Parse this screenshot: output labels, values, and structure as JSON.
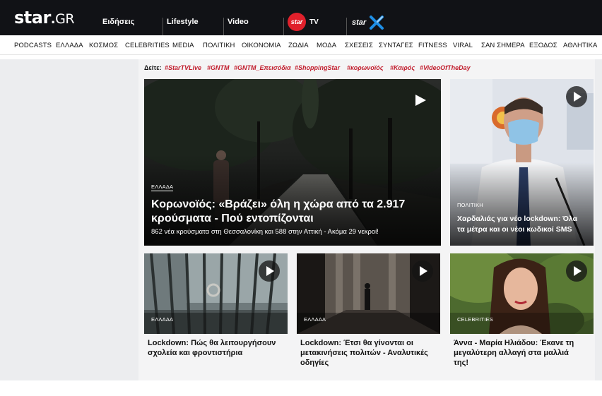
{
  "header": {
    "logo_star": "star",
    "logo_dot": ".",
    "logo_gr": "GR",
    "nav": [
      "Ειδήσεις",
      "Lifestyle",
      "Video"
    ],
    "startv_badge": "star",
    "startv_tv": "TV",
    "starx_text": "star"
  },
  "categories": [
    "PODCASTS",
    "ΕΛΛΑΔΑ",
    "ΚΟΣΜΟΣ",
    "CELEBRITIES",
    "MEDIA",
    "ΠΟΛΙΤΙΚΗ",
    "ΟΙΚΟΝΟΜΙΑ",
    "ΖΩΔΙΑ",
    "ΜΟΔΑ",
    "ΣΧΕΣΕΙΣ",
    "ΣΥΝΤΑΓΕΣ",
    "FITNESS",
    "VIRAL",
    "ΣΑΝ ΣΗΜΕΡΑ",
    "ΕΞΟΔΟΣ",
    "ΑΘΛΗΤΙΚΑ"
  ],
  "trending": {
    "label": "Δείτε:",
    "tags": [
      "#StarTVLive",
      "#GNTM",
      "#GNTM_Επεισόδια",
      "#ShoppingStar",
      "#κορωνοϊός",
      "#Καιρός",
      "#VideoOfTheDay"
    ]
  },
  "main_story": {
    "category": "ΕΛΛΑΔΑ",
    "title_line1": "Κορωνοϊός: «Βράζει» όλη η χώρα από τα 2.917",
    "title_line2": "κρούσματα - Πού εντοπίζονται",
    "subtitle": "862 νέα κρούσματα στη Θεσσαλονίκη και 588 στην Αττική - Ακόμα 29 νεκροί!"
  },
  "side_story": {
    "category": "ΠΟΛΙΤΙΚΗ",
    "title_line1": "Χαρδαλιάς για νέο lockdown: Όλα",
    "title_line2": "τα μέτρα και οι νέοι κωδικοί SMS"
  },
  "bottom_stories": [
    {
      "category": "ΕΛΛΑΔΑ",
      "title_line1": "Lockdown: Πώς θα λειτουργήσουν",
      "title_line2": "σχολεία και φροντιστήρια",
      "title_line3": ""
    },
    {
      "category": "ΕΛΛΑΔΑ",
      "title_line1": "Lockdown: Έτσι θα γίνονται οι",
      "title_line2": "μετακινήσεις πολιτών - Αναλυτικές",
      "title_line3": "οδηγίες"
    },
    {
      "category": "CELEBRITIES",
      "title_line1": "Άννα - Μαρία Ηλιάδου: Έκανε τη",
      "title_line2": "μεγαλύτερη αλλαγή στα μαλλιά",
      "title_line3": "της!"
    }
  ],
  "colors": {
    "topbar": "#111216",
    "accent_red": "#e0202b",
    "tag_red": "#c11b2b",
    "starx_blue": "#1e8fe6"
  }
}
